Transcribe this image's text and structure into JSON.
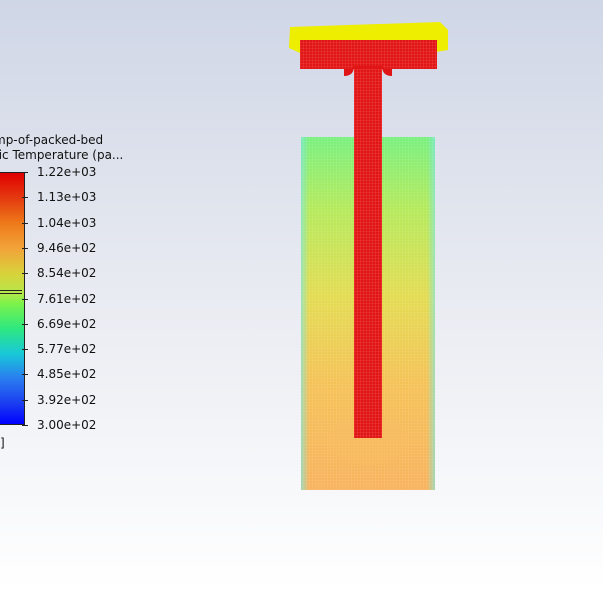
{
  "legend": {
    "title_line1": "mp-of-packed-bed",
    "title_line2": "tic Temperature (pa...",
    "unit": "]",
    "ticks": [
      "1.22e+03",
      "1.13e+03",
      "1.04e+03",
      "9.46e+02",
      "8.54e+02",
      "7.61e+02",
      "6.69e+02",
      "5.77e+02",
      "4.85e+02",
      "3.92e+02",
      "3.00e+02"
    ]
  },
  "colors": {
    "hot": "#e01212",
    "lid_highlight": "#f0f000",
    "bed_top": "#7df07a",
    "bed_bottom": "#f7b460"
  }
}
